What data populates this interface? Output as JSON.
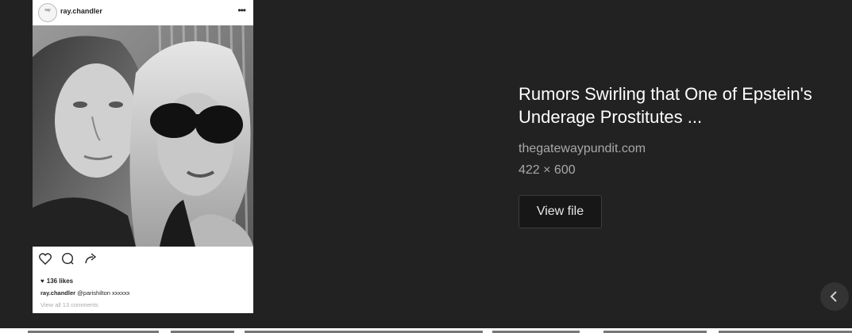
{
  "preview": {
    "username": "ray.chandler",
    "avatar_text": "ray",
    "more_icon": "more-horizontal-icon",
    "likes": "136 likes",
    "caption_user": "ray.chandler",
    "caption_text": "@parishilton xxxxxx",
    "comments_link": "View all 13 comments"
  },
  "info": {
    "title": "Rumors Swirling that One of Epstein's Underage Prostitutes ...",
    "source": "thegatewaypundit.com",
    "dimensions": "422 × 600",
    "view_button": "View file"
  },
  "colors": {
    "background": "#222222",
    "title": "#ffffff",
    "meta": "#a8a8a8",
    "button_bg": "#171717"
  }
}
